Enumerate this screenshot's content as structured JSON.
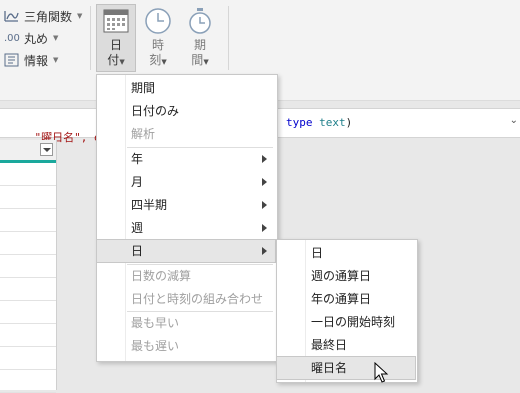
{
  "ribbon": {
    "small_buttons": [
      {
        "label": "三角関数",
        "icon": "trig-icon"
      },
      {
        "label": "丸め",
        "icon": "rounding-icon"
      },
      {
        "label": "情報",
        "icon": "info-icon"
      }
    ],
    "large_buttons": [
      {
        "label_line1": "日",
        "label_line2": "付",
        "icon": "calendar-icon"
      },
      {
        "label_line1": "時",
        "label_line2": "刻",
        "icon": "clock-icon"
      },
      {
        "label_line1": "期",
        "label_line2": "間",
        "icon": "stopwatch-icon"
      }
    ]
  },
  "formula": {
    "left_text": "\"曜日名\", each",
    "right_text_kw": "type",
    "right_text_type": "text",
    "right_text_close": ")"
  },
  "menu": {
    "items": [
      {
        "label": "期間",
        "enabled": true
      },
      {
        "label": "日付のみ",
        "enabled": true
      },
      {
        "label": "解析",
        "enabled": false
      },
      {
        "label": "年",
        "enabled": true,
        "submenu": true
      },
      {
        "label": "月",
        "enabled": true,
        "submenu": true
      },
      {
        "label": "四半期",
        "enabled": true,
        "submenu": true
      },
      {
        "label": "週",
        "enabled": true,
        "submenu": true
      },
      {
        "label": "日",
        "enabled": true,
        "submenu": true,
        "highlighted": true
      },
      {
        "label": "日数の減算",
        "enabled": false
      },
      {
        "label": "日付と時刻の組み合わせ",
        "enabled": false
      },
      {
        "label": "最も早い",
        "enabled": false
      },
      {
        "label": "最も遅い",
        "enabled": false
      }
    ]
  },
  "submenu": {
    "items": [
      {
        "label": "日"
      },
      {
        "label": "週の通算日"
      },
      {
        "label": "年の通算日"
      },
      {
        "label": "一日の開始時刻"
      },
      {
        "label": "最終日"
      },
      {
        "label": "曜日名",
        "highlighted": true
      }
    ]
  },
  "colors": {
    "accent": "#1aa89c",
    "string": "#a31515",
    "keyword": "#0000cc",
    "type": "#1f7f8a"
  }
}
